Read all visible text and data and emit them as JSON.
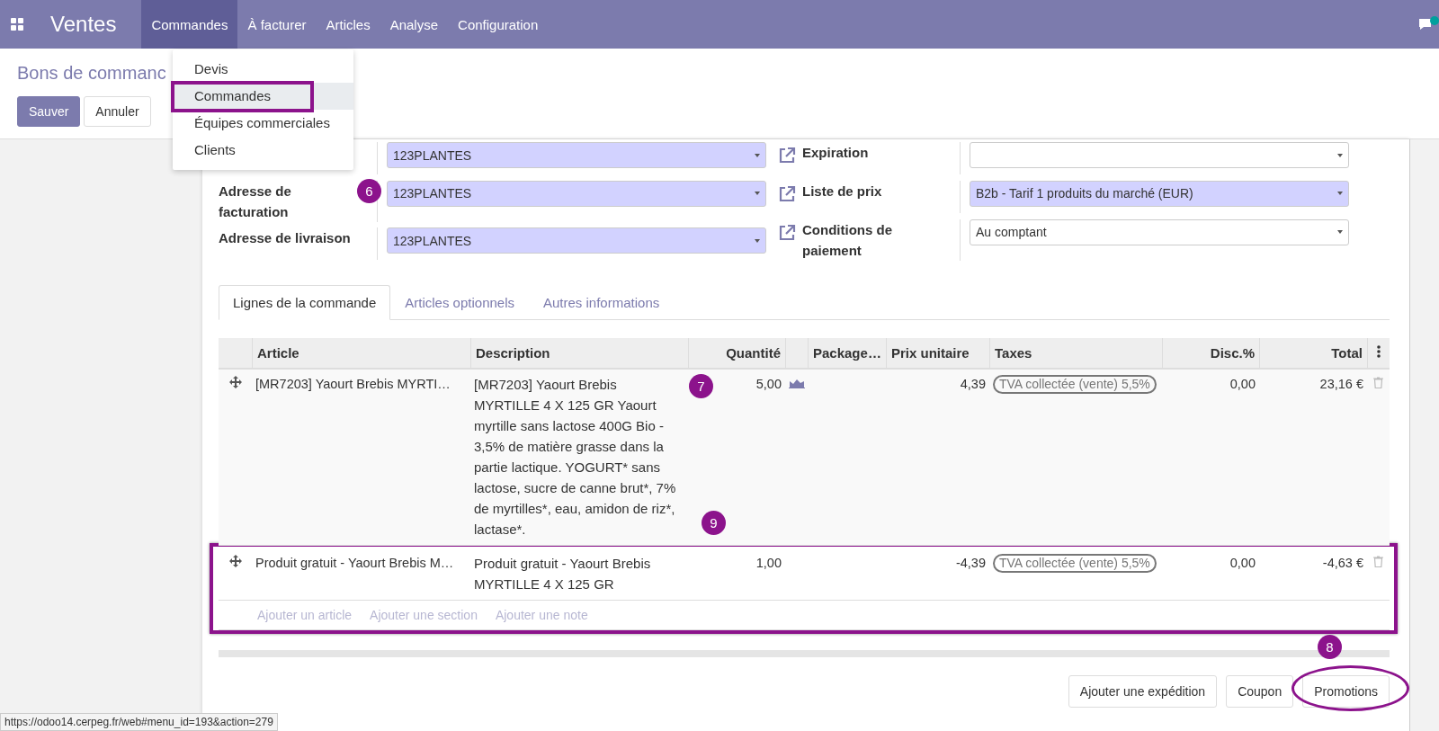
{
  "navbar": {
    "app_name": "Ventes",
    "menu": [
      {
        "label": "Commandes",
        "selected": true
      },
      {
        "label": "À facturer",
        "selected": false
      },
      {
        "label": "Articles",
        "selected": false
      },
      {
        "label": "Analyse",
        "selected": false
      },
      {
        "label": "Configuration",
        "selected": false
      }
    ]
  },
  "dropdown": [
    {
      "label": "Devis",
      "selected": false
    },
    {
      "label": "Commandes",
      "selected": true
    },
    {
      "label": "Équipes commerciales",
      "selected": false
    },
    {
      "label": "Clients",
      "selected": false
    }
  ],
  "breadcrumb": "Bons de commanc",
  "buttons": [
    {
      "label": "Sauver",
      "kind": "primary"
    },
    {
      "label": "Annuler",
      "kind": "secondary"
    }
  ],
  "form_left": [
    {
      "value": "123PLANTES",
      "required": true
    },
    {
      "label": "Adresse de facturation",
      "value": "123PLANTES",
      "required": true
    },
    {
      "label": "Adresse de livraison",
      "value": "123PLANTES",
      "required": true
    }
  ],
  "form_right": [
    {
      "label": "Expiration",
      "required": false
    },
    {
      "label": "Liste de prix",
      "value": "B2b - Tarif 1 produits du marché (EUR)",
      "required": true
    },
    {
      "label": "Conditions de paiement",
      "value": "Au comptant",
      "required": false
    }
  ],
  "tabs": [
    {
      "label": "Lignes de la commande",
      "selected": true
    },
    {
      "label": "Articles optionnels",
      "selected": false
    },
    {
      "label": "Autres informations",
      "selected": false
    }
  ],
  "table": {
    "columns": [
      "Article",
      "Description",
      "Quantité",
      "Package…",
      "Prix unitaire",
      "Taxes",
      "Disc.%",
      "Total"
    ],
    "rows": [
      {
        "article": "[MR7203] Yaourt Brebis MYRTI…",
        "description": "[MR7203] Yaourt Brebis MYRTILLE 4 X 125 GR Yaourt myrtille sans lactose 400G Bio - 3,5% de matière grasse dans la partie lactique. YOGURT* sans lactose, sucre de canne brut*, 7% de myrtilles*, eau, amidon de riz*, lactase*.",
        "quantity": "5,00",
        "forecast_icon": true,
        "price": "4,39",
        "tax": "TVA collectée (vente) 5,5%",
        "discount": "0,00",
        "total": "23,16 €"
      },
      {
        "article": "Produit gratuit - Yaourt Brebis M…",
        "description": "Produit gratuit - Yaourt Brebis MYRTILLE 4 X 125 GR",
        "quantity": "1,00",
        "forecast_icon": false,
        "price": "-4,39",
        "tax": "TVA collectée (vente) 5,5%",
        "discount": "0,00",
        "total": "-4,63 €"
      }
    ],
    "add_links": [
      "Ajouter un article",
      "Ajouter une section",
      "Ajouter une note"
    ]
  },
  "footer_buttons": [
    "Ajouter une expédition",
    "Coupon",
    "Promotions"
  ],
  "annotations": [
    "6",
    "7",
    "9",
    "8"
  ],
  "status_url": "https://odoo14.cerpeg.fr/web#menu_id=193&action=279"
}
